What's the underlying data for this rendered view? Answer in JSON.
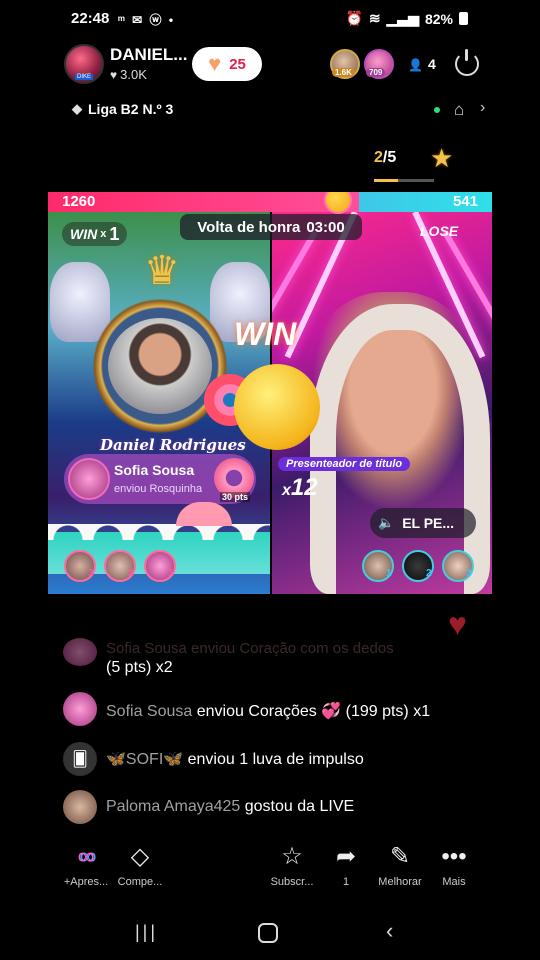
{
  "status": {
    "time": "22:48",
    "notifications": "ᵐ ✉ ⓦ •",
    "battery": "82%"
  },
  "host": {
    "name": "DANIEL...",
    "likes": "3.0K",
    "gift_count": "25"
  },
  "viewers": {
    "badges": [
      "1.6K",
      "709"
    ],
    "count": "4"
  },
  "league": {
    "label": "Liga B2 N.º 3"
  },
  "round": {
    "current": "2",
    "total": "/5"
  },
  "battle": {
    "score_left": "1260",
    "score_right": "541",
    "score_left_fraction": 0.7,
    "win_label": "WIN",
    "win_multiplier_x": "x",
    "win_multiplier": "1",
    "timer_label": "Volta de honra",
    "timer_value": "03:00",
    "lose_label": "LOSE",
    "big_win": "WIN",
    "host_caption": "Daniel Rodrigues",
    "gift_sender": "Sofia Sousa",
    "gift_action": "enviou Rosquinha",
    "gift_points": "30 pts",
    "presenter_title": "Presenteador de título",
    "presenter_x": "x",
    "presenter_count": "12",
    "opponent_name": "EL PE...",
    "left_ranks": [
      "3",
      "2",
      "1"
    ],
    "right_ranks": [
      "1",
      "2",
      "3"
    ]
  },
  "comments": {
    "faded": "Sofia Sousa enviou Coração com os dedos",
    "faded_pts": "(5 pts) x2",
    "c1_name": "Sofia Sousa",
    "c1_text": " enviou Corações ",
    "c1_pts": " (199 pts) x1",
    "c2_name": "SOFI",
    "c2_text": " enviou 1 luva de impulso",
    "c3_name": "Paloma Amaya425",
    "c3_text": " gostou da LIVE"
  },
  "actions": {
    "a1": "+Apres...",
    "a2": "Compe...",
    "a3": "Subscr...",
    "a4": "1",
    "a5": "Melhorar",
    "a6": "Mais"
  },
  "colors": {
    "accent_pink": "#ff2a6a",
    "accent_cyan": "#3fc7e8",
    "gold": "#f3c24a"
  }
}
